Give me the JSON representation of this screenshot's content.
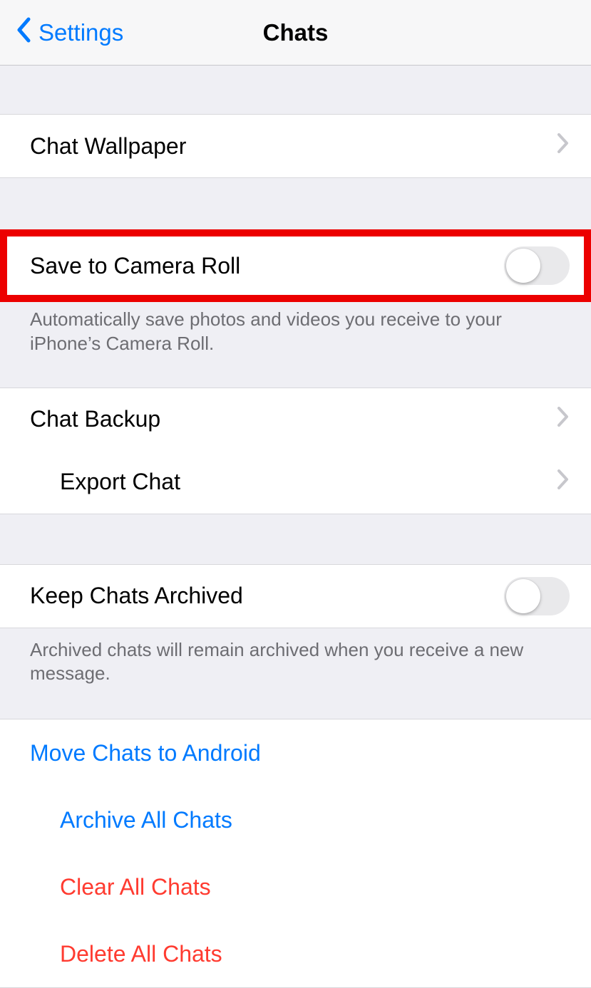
{
  "nav": {
    "back": "Settings",
    "title": "Chats"
  },
  "wallpaper": {
    "label": "Chat Wallpaper"
  },
  "save_roll": {
    "label": "Save to Camera Roll",
    "on": false,
    "footer": "Automatically save photos and videos you receive to your iPhone’s Camera Roll."
  },
  "backup": {
    "label": "Chat Backup"
  },
  "export": {
    "label": "Export Chat"
  },
  "keep_archived": {
    "label": "Keep Chats Archived",
    "on": false,
    "footer": "Archived chats will remain archived when you receive a new message."
  },
  "actions": {
    "move": "Move Chats to Android",
    "archive": "Archive All Chats",
    "clear": "Clear All Chats",
    "delete": "Delete All Chats"
  }
}
